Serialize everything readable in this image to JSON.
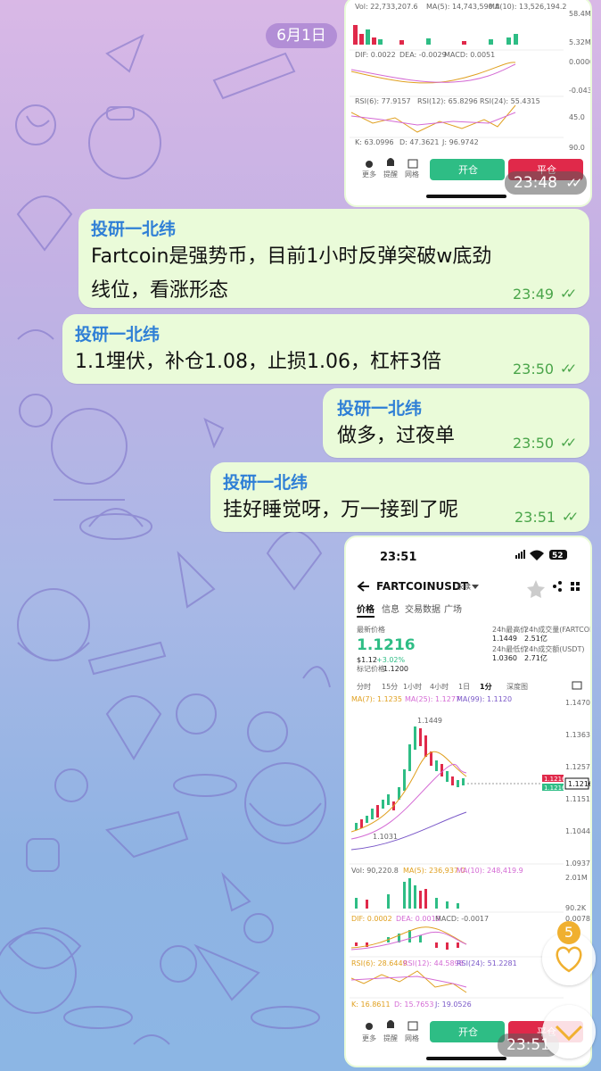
{
  "date_label": "6月1日",
  "colors": {
    "bubble": "#eafbd9",
    "sender": "#2f7fd6",
    "time": "#4aa54a",
    "up": "#2ebd85",
    "down": "#e0294a"
  },
  "top_screenshot": {
    "vol_label": "Vol: 22,733,207.6",
    "ma5_label": "MA(5): 14,743,590.8",
    "ma10_label": "MA(10): 13,526,194.2",
    "vol_right1": "58.4M",
    "vol_right2": "5.32M",
    "dif_label": "DIF: 0.0022",
    "dea_label": "DEA: -0.0029",
    "macd_label": "MACD: 0.0051",
    "macd_right1": "0.0000",
    "macd_right2": "-0.0431",
    "rsi_label": "RSI(6): 77.9157",
    "rsi12_label": "RSI(12): 65.8296",
    "rsi24_label": "RSI(24): 55.4315",
    "rsi_right": "45.0",
    "kdj_label": "K: 63.0996",
    "kdj_d": "D: 47.3621",
    "kdj_j": "J: 96.9742",
    "kdj_right": "90.0",
    "more": "更多",
    "remind": "提醒",
    "grid": "网格",
    "open_btn": "开仓",
    "close_btn": "平仓",
    "time": "23:48"
  },
  "messages": [
    {
      "sender": "投研一北纬",
      "lines": [
        "Fartcoin是强势币，目前1小时反弹突破w底劲",
        "线位，看涨形态"
      ],
      "time": "23:49"
    },
    {
      "sender": "投研一北纬",
      "lines": [
        "1.1埋伏，补仓1.08，止损1.06，杠杆3倍"
      ],
      "time": "23:50"
    },
    {
      "sender": "投研一北纬",
      "lines": [
        "做多，过夜单"
      ],
      "time": "23:50"
    },
    {
      "sender": "投研一北纬",
      "lines": [
        "挂好睡觉呀，万一接到了呢"
      ],
      "time": "23:51"
    }
  ],
  "bottom_screenshot": {
    "status_time": "23:51",
    "battery": "52",
    "symbol": "FARTCOINUSDT",
    "perp": "永续",
    "tabs": [
      "价格",
      "信息",
      "交易数据",
      "广场"
    ],
    "latest_label": "最新价格",
    "price": "1.1216",
    "usd_price": "$1.12",
    "change": "+3.02%",
    "mark_label": "标记价格",
    "mark_price": "1.1200",
    "high_label": "24h最高价",
    "high": "1.1449",
    "low_label": "24h最低价",
    "low": "1.0360",
    "vol_coin_label": "24h成交量(FARTCOIN)",
    "vol_coin": "2.51亿",
    "vol_usdt_label": "24h成交额(USDT)",
    "vol_usdt": "2.71亿",
    "intervals": [
      "分时",
      "15分",
      "1小时",
      "4小时",
      "1日",
      "1分",
      "深度图"
    ],
    "ma7": "MA(7): 1.1235",
    "ma25": "MA(25): 1.1277",
    "ma99": "MA(99): 1.1120",
    "axis": [
      "1.1470",
      "1.1363",
      "1.1257",
      "1.1151",
      "1.1044",
      "1.0937"
    ],
    "peak_label": "1.1449",
    "bottom_label": "1.1031",
    "price_tag1": "1.1216",
    "price_tag2": "1.1216",
    "vol_label": "Vol: 90,220.8",
    "vol_ma5": "MA(5): 236,937.0",
    "vol_ma10": "MA(10): 248,419.9",
    "vol_axis": [
      "2.01M",
      "90.2K"
    ],
    "dif": "DIF: 0.0002",
    "dea": "DEA: 0.0019",
    "macd": "MACD: -0.0017",
    "macd_axis": "0.0078",
    "rsi6": "RSI(6): 28.6449",
    "rsi12": "RSI(12): 44.5898",
    "rsi24": "RSI(24): 51.2281",
    "kdj": "K: 16.8611",
    "kdj_d": "D: 15.7653",
    "kdj_j": "J: 19.0526",
    "more": "更多",
    "remind": "提醒",
    "grid": "网格",
    "open_btn": "开仓",
    "close_btn": "平仓",
    "time": "23:51"
  },
  "fab": {
    "badge": "5"
  }
}
